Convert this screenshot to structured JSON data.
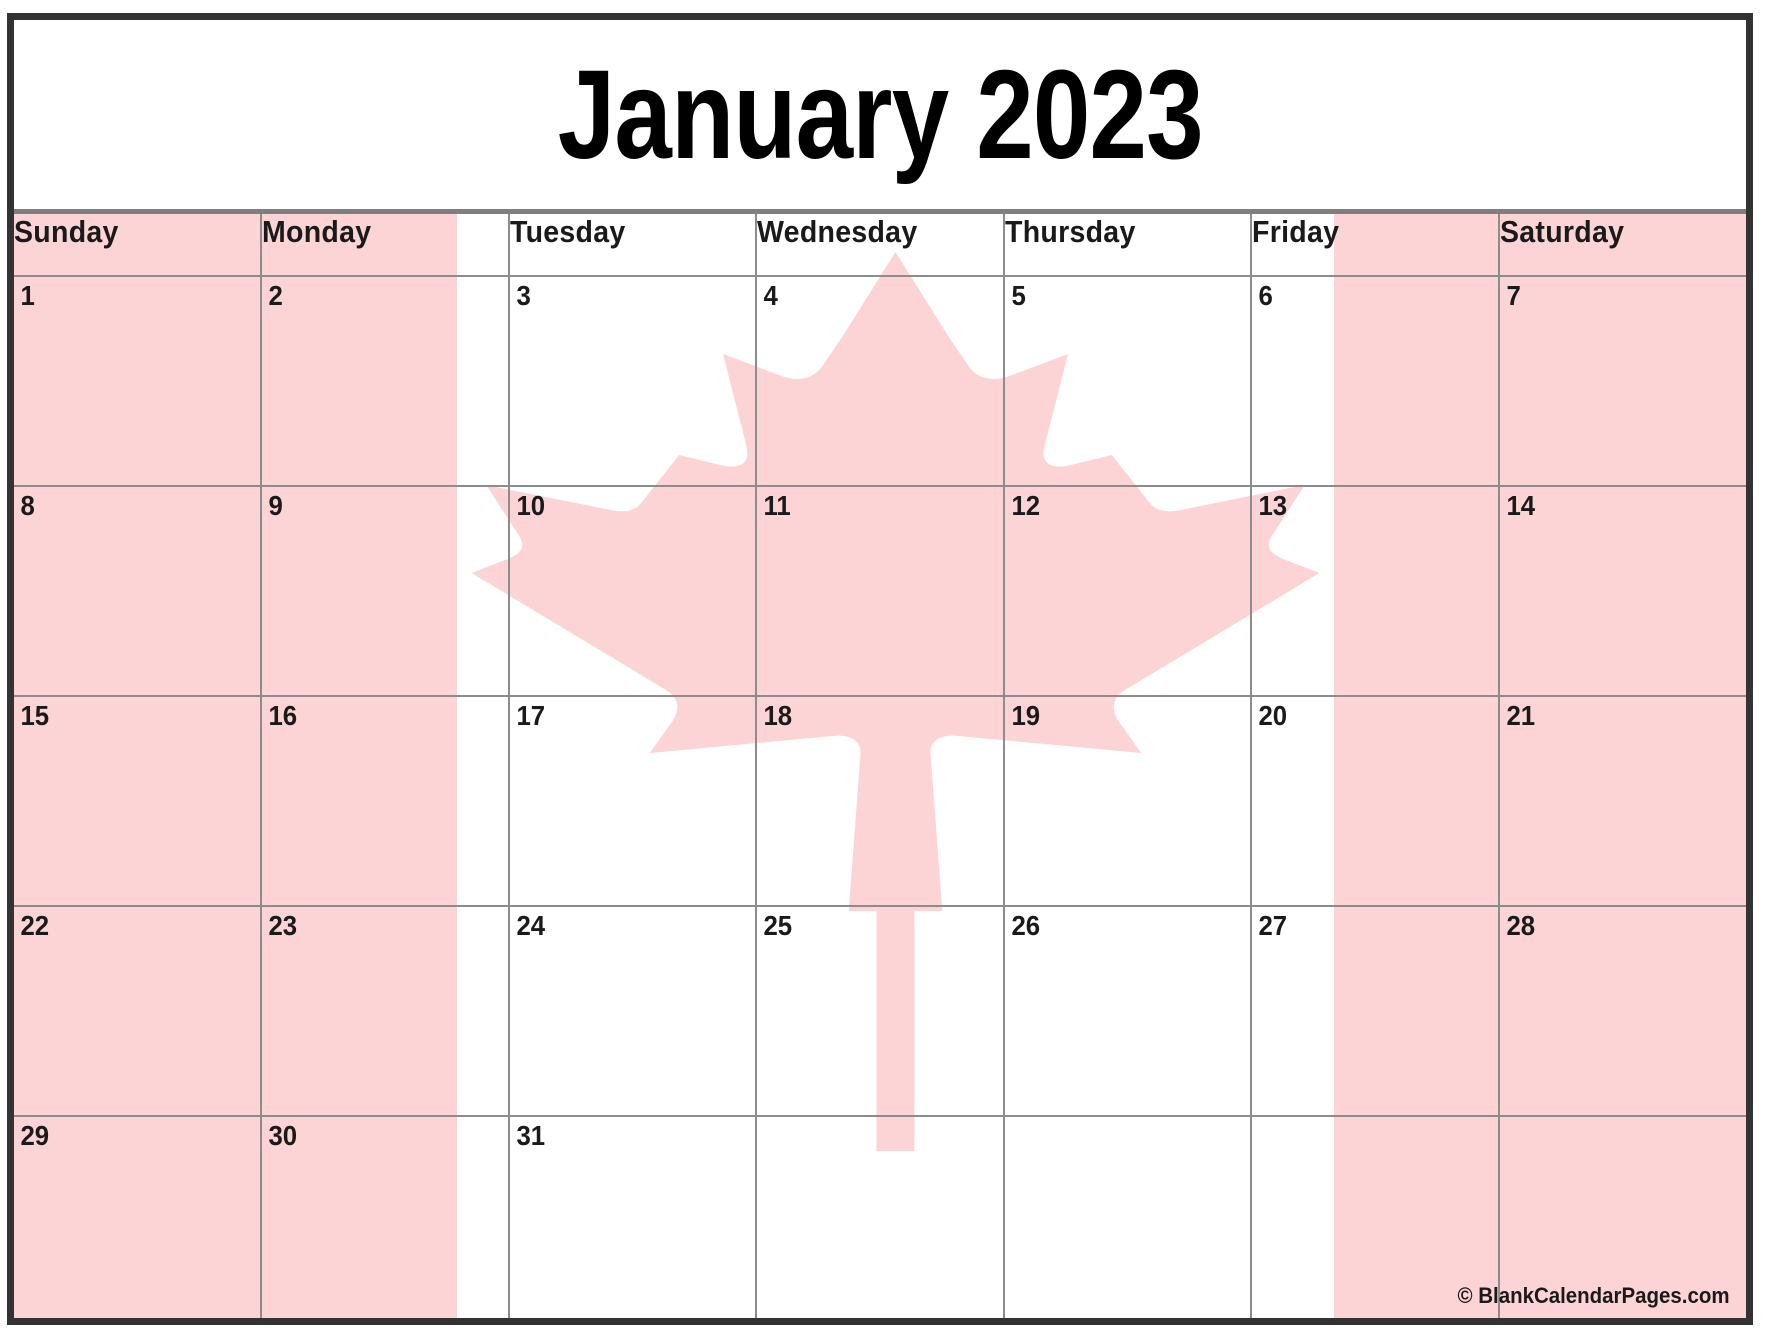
{
  "title": "January 2023",
  "month": "January",
  "year": "2023",
  "credit": "© BlankCalendarPages.com",
  "colors": {
    "flag_pink": "#fcd4d5",
    "header_bg": "#f4f4f4",
    "grid_line": "#8c8c8c",
    "outer_border": "#333333",
    "text": "#1a1a1a"
  },
  "weekdays": [
    {
      "label": "Sunday"
    },
    {
      "label": "Monday"
    },
    {
      "label": "Tuesday"
    },
    {
      "label": "Wednesday"
    },
    {
      "label": "Thursday"
    },
    {
      "label": "Friday"
    },
    {
      "label": "Saturday"
    }
  ],
  "weeks": [
    {
      "days": [
        {
          "n": "1"
        },
        {
          "n": "2"
        },
        {
          "n": "3"
        },
        {
          "n": "4"
        },
        {
          "n": "5"
        },
        {
          "n": "6"
        },
        {
          "n": "7"
        }
      ]
    },
    {
      "days": [
        {
          "n": "8"
        },
        {
          "n": "9"
        },
        {
          "n": "10"
        },
        {
          "n": "11"
        },
        {
          "n": "12"
        },
        {
          "n": "13"
        },
        {
          "n": "14"
        }
      ]
    },
    {
      "days": [
        {
          "n": "15"
        },
        {
          "n": "16"
        },
        {
          "n": "17"
        },
        {
          "n": "18"
        },
        {
          "n": "19"
        },
        {
          "n": "20"
        },
        {
          "n": "21"
        }
      ]
    },
    {
      "days": [
        {
          "n": "22"
        },
        {
          "n": "23"
        },
        {
          "n": "24"
        },
        {
          "n": "25"
        },
        {
          "n": "26"
        },
        {
          "n": "27"
        },
        {
          "n": "28"
        }
      ]
    },
    {
      "days": [
        {
          "n": "29"
        },
        {
          "n": "30"
        },
        {
          "n": "31"
        },
        {
          "n": ""
        },
        {
          "n": ""
        },
        {
          "n": ""
        },
        {
          "n": ""
        }
      ]
    }
  ],
  "background_image": {
    "name": "canada-flag",
    "description": "Canadian flag watermark: two vertical pink bands with a pink maple leaf centered"
  }
}
